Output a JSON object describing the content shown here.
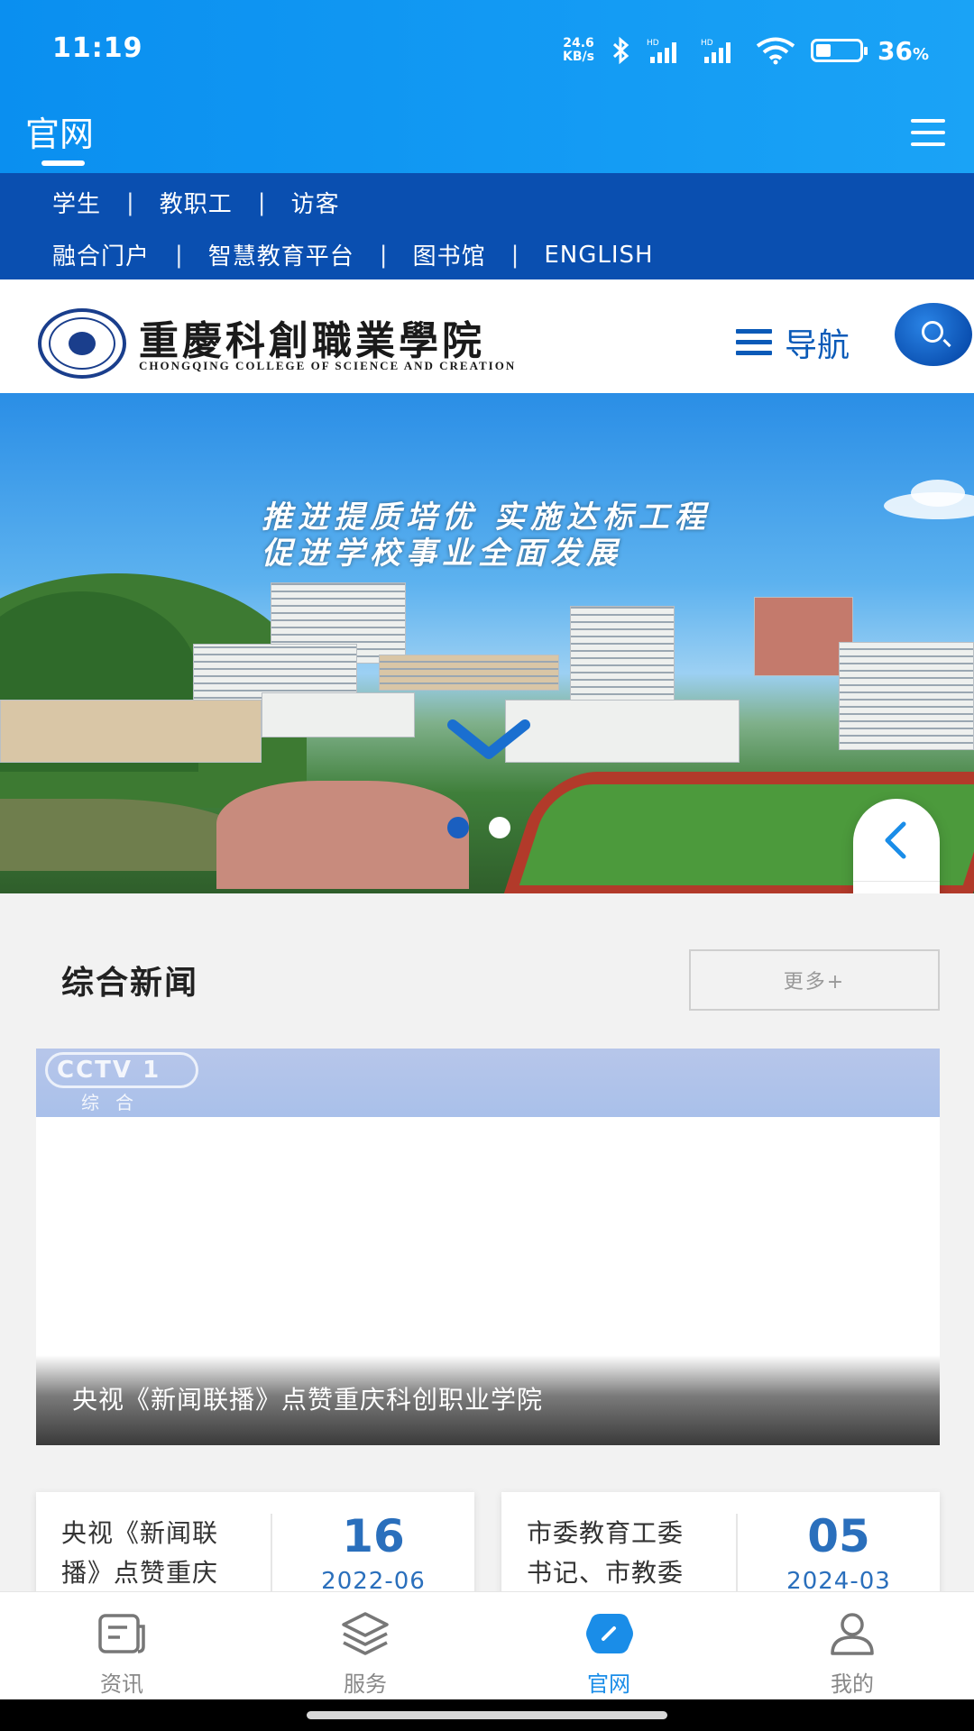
{
  "status_bar": {
    "time": "11:19",
    "net_speed_value": "24.6",
    "net_speed_unit": "KB/s",
    "battery_percent": "36",
    "battery_unit": "%"
  },
  "header": {
    "title": "官网"
  },
  "site_nav": {
    "row1": [
      "学生",
      "教职工",
      "访客"
    ],
    "row2": [
      "融合门户",
      "智慧教育平台",
      "图书馆",
      "ENGLISH"
    ],
    "separator": "|"
  },
  "logo": {
    "name_cn": "重慶科創職業學院",
    "name_en": "CHONGQING COLLEGE OF SCIENCE AND CREATION"
  },
  "nav_button": {
    "label": "导航"
  },
  "banner": {
    "slogan_line1": "推进提质培优 实施达标工程",
    "slogan_line2": "促进学校事业全面发展",
    "slide_count": 2,
    "active_slide": 2
  },
  "news": {
    "section_title": "综合新闻",
    "more_label": "更多+",
    "feature": {
      "logo_text": "CCTV 1",
      "logo_sub": "综合",
      "caption": "央视《新闻联播》点赞重庆科创职业学院"
    },
    "cards": [
      {
        "line1": "央视《新闻联",
        "line2": "播》点赞重庆",
        "day": "16",
        "year_month": "2022-06"
      },
      {
        "line1": "市委教育工委",
        "line2": "书记、市教委",
        "day": "05",
        "year_month": "2024-03"
      }
    ]
  },
  "tabbar": {
    "tabs": [
      {
        "label": "资讯",
        "icon": "news-icon"
      },
      {
        "label": "服务",
        "icon": "layers-icon"
      },
      {
        "label": "官网",
        "icon": "compass-icon",
        "active": true
      },
      {
        "label": "我的",
        "icon": "user-icon"
      }
    ]
  },
  "colors": {
    "header_blue": "#0a8ff0",
    "nav_blue": "#0a4fb0",
    "accent_blue": "#1a8de8",
    "date_blue": "#2a6fbc"
  }
}
